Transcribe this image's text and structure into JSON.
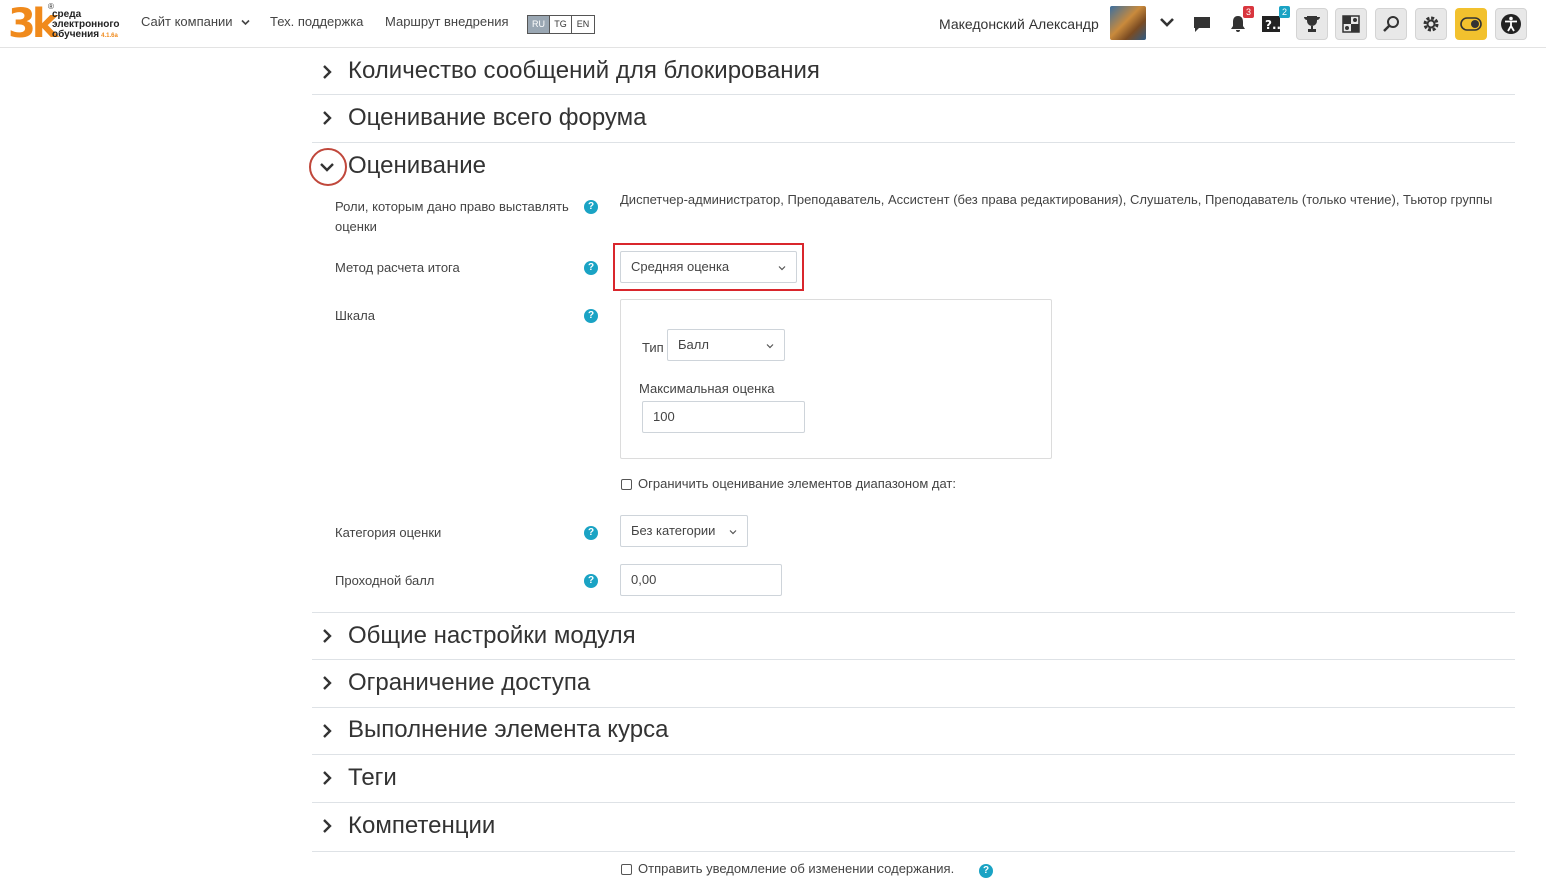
{
  "navbar": {
    "logo": {
      "big": "3k",
      "reg": "®",
      "line1": "среда",
      "line2": "электронного",
      "line3": "обучения",
      "version": "4.1.6a"
    },
    "links": [
      {
        "label": "Сайт компании",
        "has_caret": true
      },
      {
        "label": "Тех. поддержка"
      },
      {
        "label": "Маршрут внедрения"
      }
    ],
    "languages": [
      "RU",
      "TG",
      "EN"
    ],
    "active_language": "RU",
    "user_name": "Македонский Александр",
    "notifications_count": "3",
    "questions_count": "2",
    "icons": [
      "chevron-down-icon",
      "chat-icon",
      "bell-icon",
      "question-icon",
      "trophy-icon",
      "chess-icon",
      "search-icon",
      "gear-icon",
      "toggle-icon",
      "accessibility-icon"
    ]
  },
  "sections_top": [
    {
      "title": "Количество сообщений для блокирования",
      "expanded": false
    },
    {
      "title": "Оценивание всего форума",
      "expanded": false
    },
    {
      "title": "Оценивание",
      "expanded": true
    }
  ],
  "grading": {
    "roles_label": "Роли, которым дано право выставлять оценки",
    "roles_value": "Диспетчер-администратор, Преподаватель, Ассистент (без права редактирования), Слушатель, Преподаватель (только чтение), Тьютор группы",
    "aggregate_label": "Метод расчета итога",
    "aggregate_value": "Средняя оценка",
    "scale_label": "Шкала",
    "type_label": "Тип",
    "type_value": "Балл",
    "max_grade_label": "Максимальная оценка",
    "max_grade_value": "100",
    "limit_dates_label": "Ограничить оценивание элементов диапазоном дат:",
    "category_label": "Категория оценки",
    "category_value": "Без категории",
    "pass_grade_label": "Проходной балл",
    "pass_grade_value": "0,00",
    "help_glyph": "?"
  },
  "sections_bottom": [
    {
      "title": "Общие настройки модуля",
      "expanded": false
    },
    {
      "title": "Ограничение доступа",
      "expanded": false
    },
    {
      "title": "Выполнение элемента курса",
      "expanded": false
    },
    {
      "title": "Теги",
      "expanded": false
    },
    {
      "title": "Компетенции",
      "expanded": false
    }
  ],
  "footer": {
    "notify_label": "Отправить уведомление об изменении содержания."
  }
}
